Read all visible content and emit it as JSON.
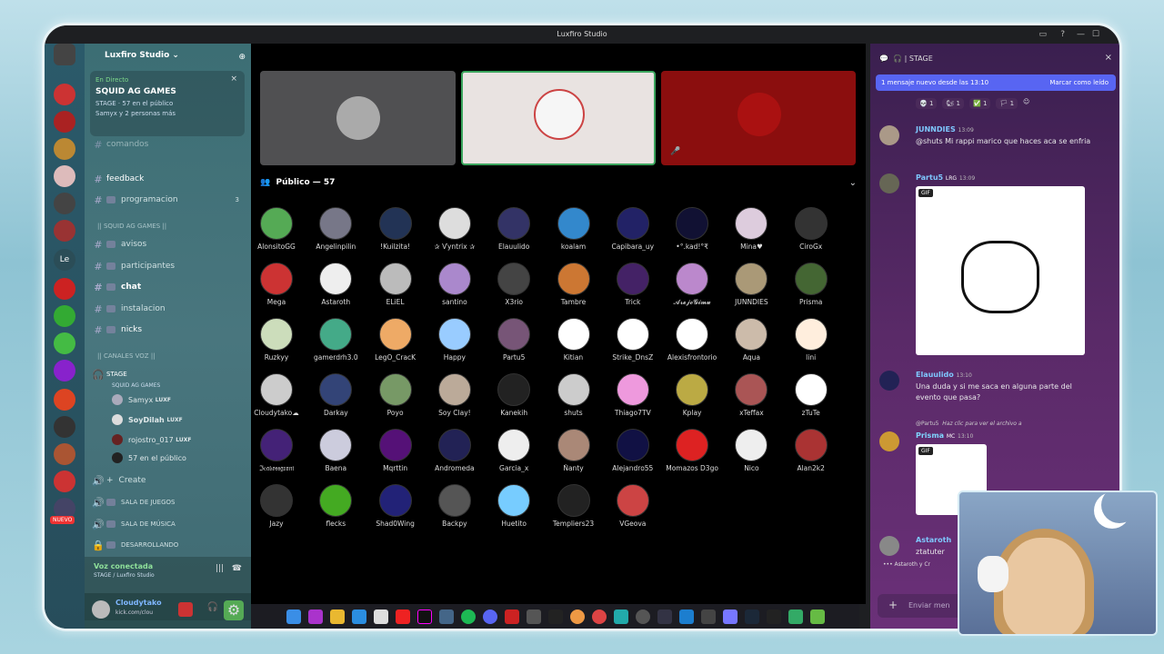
{
  "window": {
    "title": "Luxfiro Studio"
  },
  "server": {
    "name": "Luxfiro Studio"
  },
  "event": {
    "status": "En Directo",
    "name": "SQUID AG GAMES",
    "stage_label": "STAGE",
    "audience": "57 en el público",
    "speakers": "Samyx y 2 personas más"
  },
  "channels": [
    {
      "name": "comandos"
    },
    {
      "name": "feedback"
    },
    {
      "name": "programacion",
      "badge": "3"
    }
  ],
  "category1": "|| SQUID AG GAMES ||",
  "channels2": [
    {
      "name": "avisos"
    },
    {
      "name": "participantes"
    },
    {
      "name": "chat"
    },
    {
      "name": "instalacion"
    },
    {
      "name": "nicks"
    }
  ],
  "category2": "|| CANALES VOZ ||",
  "stage_channel": {
    "name": "STAGE",
    "sub": "SQUID AG GAMES"
  },
  "voice_users": [
    {
      "name": "Samyx",
      "tag": "LUXF"
    },
    {
      "name": "SoyDilah",
      "tag": "LUXF"
    },
    {
      "name": "rojostro_017",
      "tag": "LUXF"
    },
    {
      "name": "57 en el público",
      "tag": ""
    }
  ],
  "voice_channels": [
    "Create",
    "SALA DE JUEGOS",
    "SALA DE MÚSICA",
    "DESARROLLANDO"
  ],
  "server_badges": {
    "le": "Le",
    "nuevo": "NUEVO"
  },
  "voice_status": {
    "title": "Voz conectada",
    "sub": "STAGE / Luxfiro Studio"
  },
  "user_panel": {
    "name": "Cloudytako",
    "sub": "kick.com/clou"
  },
  "public": {
    "header": "Público — 57"
  },
  "audience": [
    "AlonsitoGG",
    "Angelinpilin",
    "!Kuilzita!",
    "✰ Ѵyntrix ✰",
    "Elauulido",
    "koalam",
    "Capibara_uy",
    "•°.kad!°₹",
    "Mina♥",
    "CiroGx",
    "Mega",
    "Astaroth",
    "ELiEL",
    "santino",
    "X3rio",
    "Tambre",
    "Trick",
    "𝓐𝓻𝓮𝓳𝓸𝓖𝓲𝓶𝓾",
    "JUNNDIES",
    "Prisma",
    "Ruzkyy",
    "gamerdrh3.0",
    "LegO_CracK",
    "Happy",
    "Partu5",
    "Kitian",
    "Strike_DnsZ",
    "Alexisfrontorio",
    "Aqua",
    "lini",
    "Cloudytako☁",
    "Darkay",
    "Poyo",
    "Soy Clay!",
    "Kanekih",
    "shuts",
    "Thiago7TV",
    "Kplay",
    "xTeffax",
    "zTuTe",
    "ℑ𝔢𝔞𝔟𝔬𝔰𝔰𝔤𝔯𝔞𝔫𝔦",
    "Baena",
    "Mqrttin",
    "Andromeda",
    "Garcia_x",
    "Ñanty",
    "Alejandro55",
    "Momazos D3go",
    "Nico",
    "Alan2k2",
    "Jazy",
    "flecks",
    "Shad0Wing",
    "Backpy",
    "Huetito",
    "Templiers23",
    "VGeova"
  ],
  "chat": {
    "header": "STAGE",
    "notification": "1 mensaje nuevo desde las 13:10",
    "mark_read": "Marcar como leído",
    "reactions": [
      "1",
      "1",
      "1",
      "1"
    ],
    "messages": [
      {
        "author": "JUNNDIES",
        "time": "13:09",
        "text": "@shuts Mi rappi marico que haces aca se enfria"
      },
      {
        "author": "Partu5",
        "badge": "LRG",
        "time": "13:09",
        "text": ""
      },
      {
        "author": "Elauulido",
        "time": "13:10",
        "text": "Una duda y si me saca en alguna parte del evento que pasa?"
      },
      {
        "author": "Prisma",
        "badge": "MC",
        "time": "13:10",
        "reply": "@Partu5",
        "reply_text": "Haz clic para ver el archivo a"
      },
      {
        "author": "Astaroth",
        "text": "ztatuter"
      }
    ],
    "typing": "Astaroth y Cr",
    "gif_tag": "GIF",
    "input_placeholder": "Enviar men"
  }
}
